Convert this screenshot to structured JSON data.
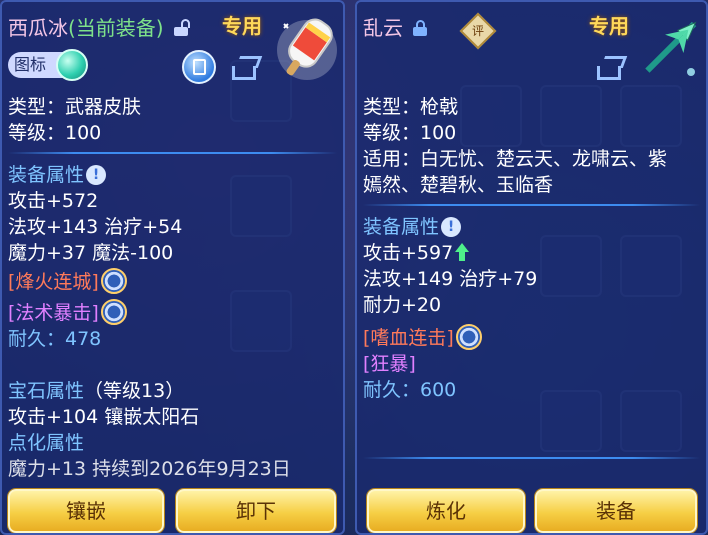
{
  "left_panel": {
    "item_name": "西瓜冰",
    "status": "(当前装备)",
    "exclusive_tag": "专用",
    "icon_label": "图标",
    "type_row": "类型：武器皮肤",
    "level_row": "等级：100",
    "equip_attr_title": "装备属性",
    "stats": [
      "攻击+572",
      "法攻+143 治疗+54",
      "魔力+37 魔法-100"
    ],
    "special_1": "[烽火连城]",
    "special_2": "[法术暴击]",
    "durability": "耐久：478",
    "gem_title": "宝石属性",
    "gem_level": "（等级13）",
    "gem_stat": "攻击+104 镶嵌太阳石",
    "enhance_title": "点化属性",
    "enhance_stat": "魔力+13 持续到2026年9月23日",
    "buttons": {
      "inlay": "镶嵌",
      "unequip": "卸下"
    }
  },
  "right_panel": {
    "item_name": "乱云",
    "rating": "评",
    "exclusive_tag": "专用",
    "type_row": "类型：枪戟",
    "level_row": "等级：100",
    "applicable_row_1": "适用：白无忧、楚云天、龙啸云、紫",
    "applicable_row_2": "嫣然、楚碧秋、玉临香",
    "equip_attr_title": "装备属性",
    "stat_attack": "攻击+597",
    "stats": [
      "法攻+149 治疗+79",
      "耐力+20"
    ],
    "special_1": "[嗜血连击]",
    "special_2": "[狂暴]",
    "durability": "耐久：600",
    "buttons": {
      "refine": "炼化",
      "equip": "装备"
    }
  },
  "colors": {
    "panel_bg": "#1a2a6e",
    "section_blue": "#7fc4ff",
    "special_red": "#ff7a5a",
    "special_purple": "#e080ff",
    "exclusive_gold": "#ffd85a",
    "button_gold": "#f6cf45"
  }
}
